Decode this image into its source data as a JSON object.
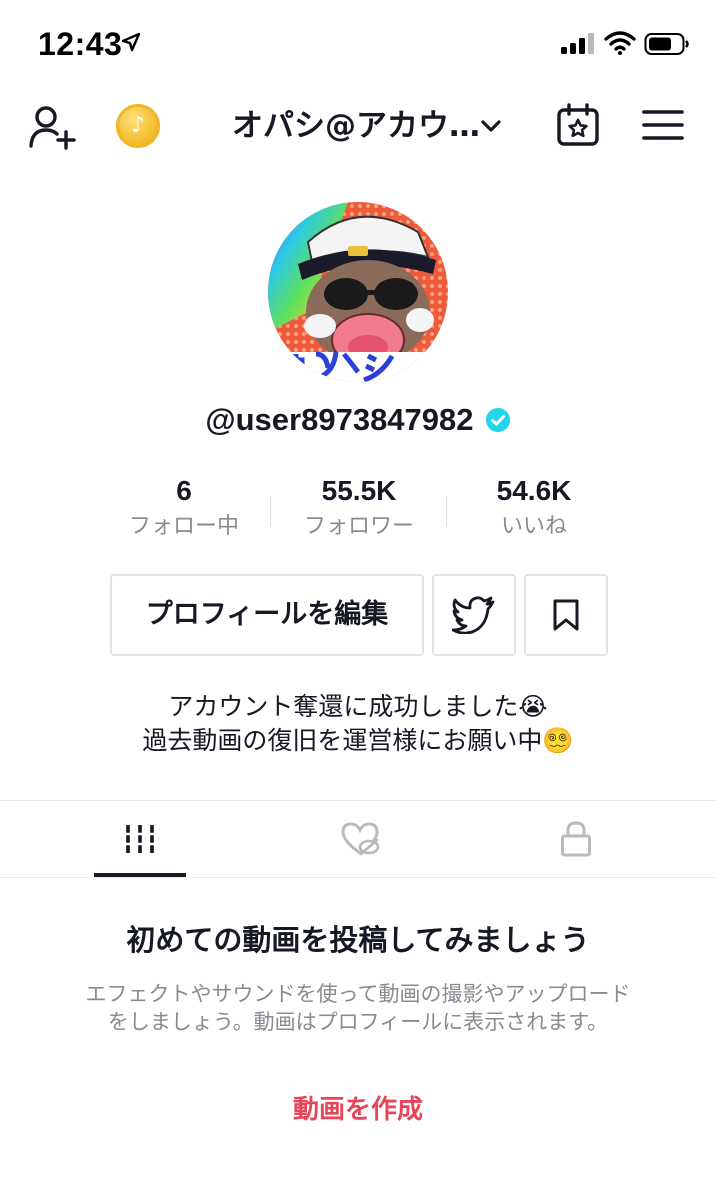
{
  "status_bar": {
    "time": "12:43",
    "icons": [
      "location-arrow-icon",
      "cellular-signal-icon",
      "wifi-icon",
      "battery-icon"
    ]
  },
  "header": {
    "account_name": "オパシ@アカウ…",
    "icons": [
      "add-user-icon",
      "coin-icon",
      "chevron-down-icon",
      "calendar-star-icon",
      "menu-icon"
    ]
  },
  "profile": {
    "username": "@user8973847982",
    "verified": true,
    "stats": [
      {
        "value": "6",
        "label": "フォロー中"
      },
      {
        "value": "55.5K",
        "label": "フォロワー"
      },
      {
        "value": "54.6K",
        "label": "いいね"
      }
    ],
    "edit_button_label": "プロフィールを編集",
    "bio_lines": [
      "アカウント奪還に成功しました😭",
      "過去動画の復旧を運営様にお願い中😵‍💫"
    ]
  },
  "tabs": [
    {
      "name": "videos",
      "icon": "grid-lines-icon",
      "active": true
    },
    {
      "name": "liked",
      "icon": "heart-hidden-icon",
      "active": false
    },
    {
      "name": "private",
      "icon": "lock-icon",
      "active": false
    }
  ],
  "empty_state": {
    "title": "初めての動画を投稿してみましょう",
    "description": "エフェクトやサウンドを使って動画の撮影やアップロードをしましょう。動画はプロフィールに表示されます。",
    "cta": "動画を作成"
  },
  "colors": {
    "text_primary": "#161823",
    "text_secondary": "#8a8b91",
    "cta_red": "#e8455b",
    "verified_blue": "#20d5ec",
    "border": "#e3e3e4"
  }
}
